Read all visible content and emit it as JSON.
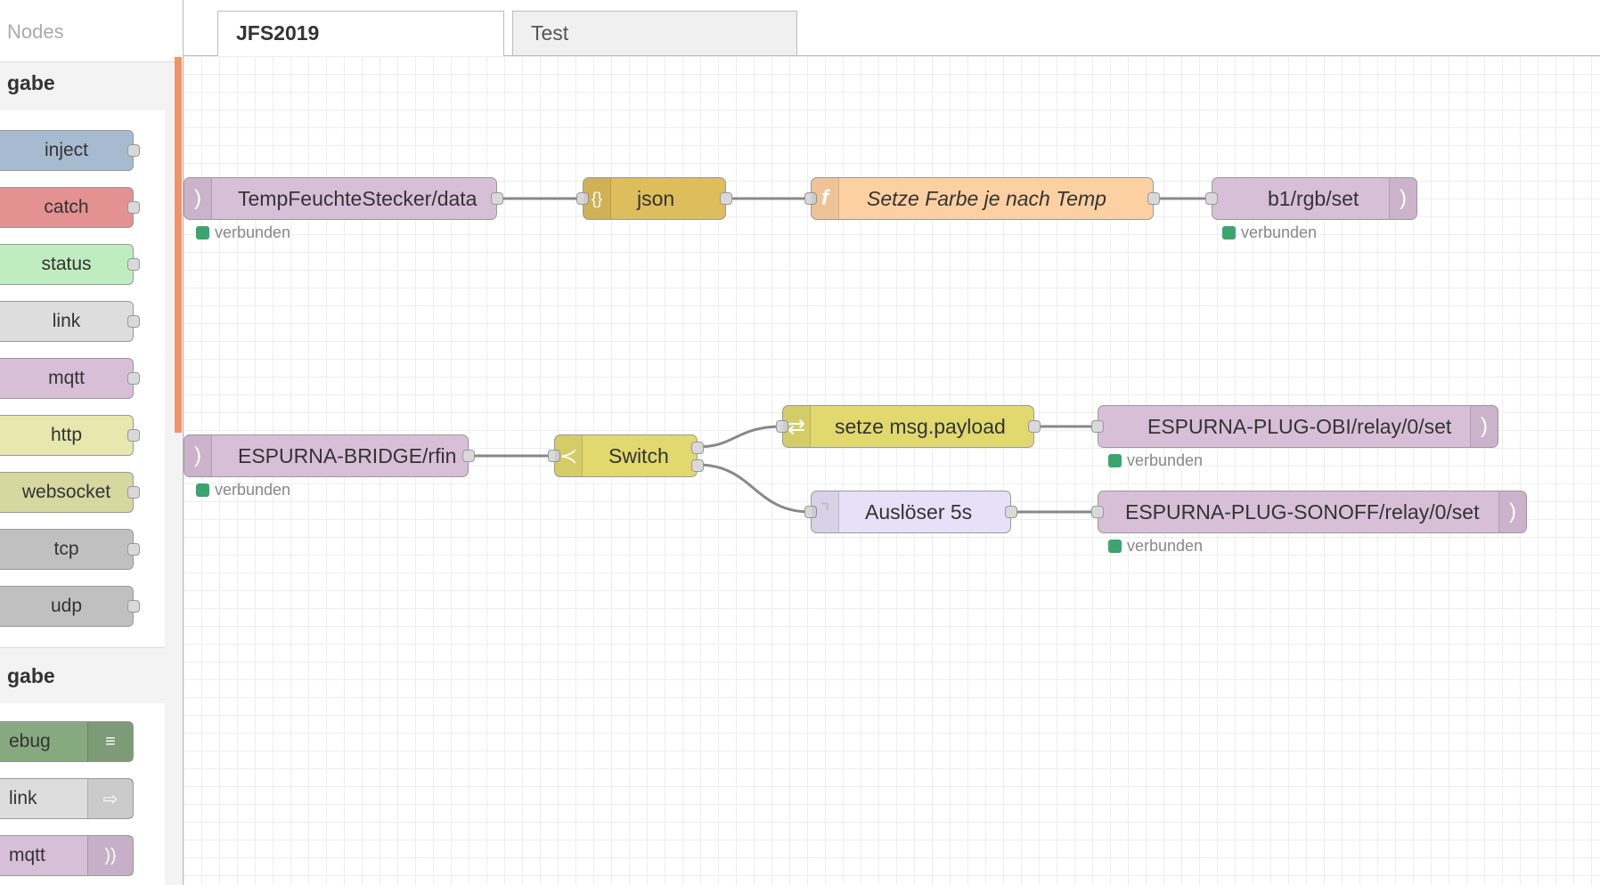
{
  "palette": {
    "search_placeholder": "Nodes",
    "categories": [
      {
        "header": "gabe"
      },
      {
        "header": "gabe"
      }
    ],
    "input_nodes": [
      "inject",
      "catch",
      "status",
      "link",
      "mqtt",
      "http",
      "websocket",
      "tcp",
      "udp"
    ],
    "output_nodes": [
      "ebug",
      "link",
      "mqtt"
    ]
  },
  "tabs": [
    {
      "label": "JFS2019",
      "active": true
    },
    {
      "label": "Test",
      "active": false
    }
  ],
  "flow": {
    "n1": {
      "label": "TempFeuchteStecker/data",
      "status": "verbunden"
    },
    "n2": {
      "label": "json"
    },
    "n3": {
      "label": "Setze Farbe je nach Temp"
    },
    "n4": {
      "label": "b1/rgb/set",
      "status": "verbunden"
    },
    "n5": {
      "label": "ESPURNA-BRIDGE/rfin",
      "status": "verbunden"
    },
    "n6": {
      "label": "Switch"
    },
    "n7": {
      "label": "setze msg.payload"
    },
    "n8": {
      "label": "ESPURNA-PLUG-OBI/relay/0/set",
      "status": "verbunden"
    },
    "n9": {
      "label": "Auslöser 5s"
    },
    "n10": {
      "label": "ESPURNA-PLUG-SONOFF/relay/0/set",
      "status": "verbunden"
    }
  },
  "colors": {
    "mqtt": "#d8bfd8",
    "json": "#debd5c",
    "function": "#fdd0a2",
    "switch": "#e2d96e",
    "change": "#e2d96e",
    "trigger": "#e6e0f8",
    "inject": "#a6bbcf",
    "catch": "#e49191",
    "status": "#c0edc0",
    "link": "#dddddd",
    "http": "#e7e7ae",
    "websocket": "#d7d7a0",
    "tcp": "#c0c0c0",
    "udp": "#c0c0c0",
    "debug": "#87a980",
    "status_connected": "#3aa56e",
    "scrollbar": "#f0936a"
  },
  "icons": {
    "mqtt": "mqtt-icon",
    "json": "json-icon",
    "function": "function-icon",
    "switch": "switch-icon",
    "change": "change-icon",
    "trigger": "trigger-icon",
    "debug": "debug-list-icon",
    "link_out": "link-out-icon"
  }
}
